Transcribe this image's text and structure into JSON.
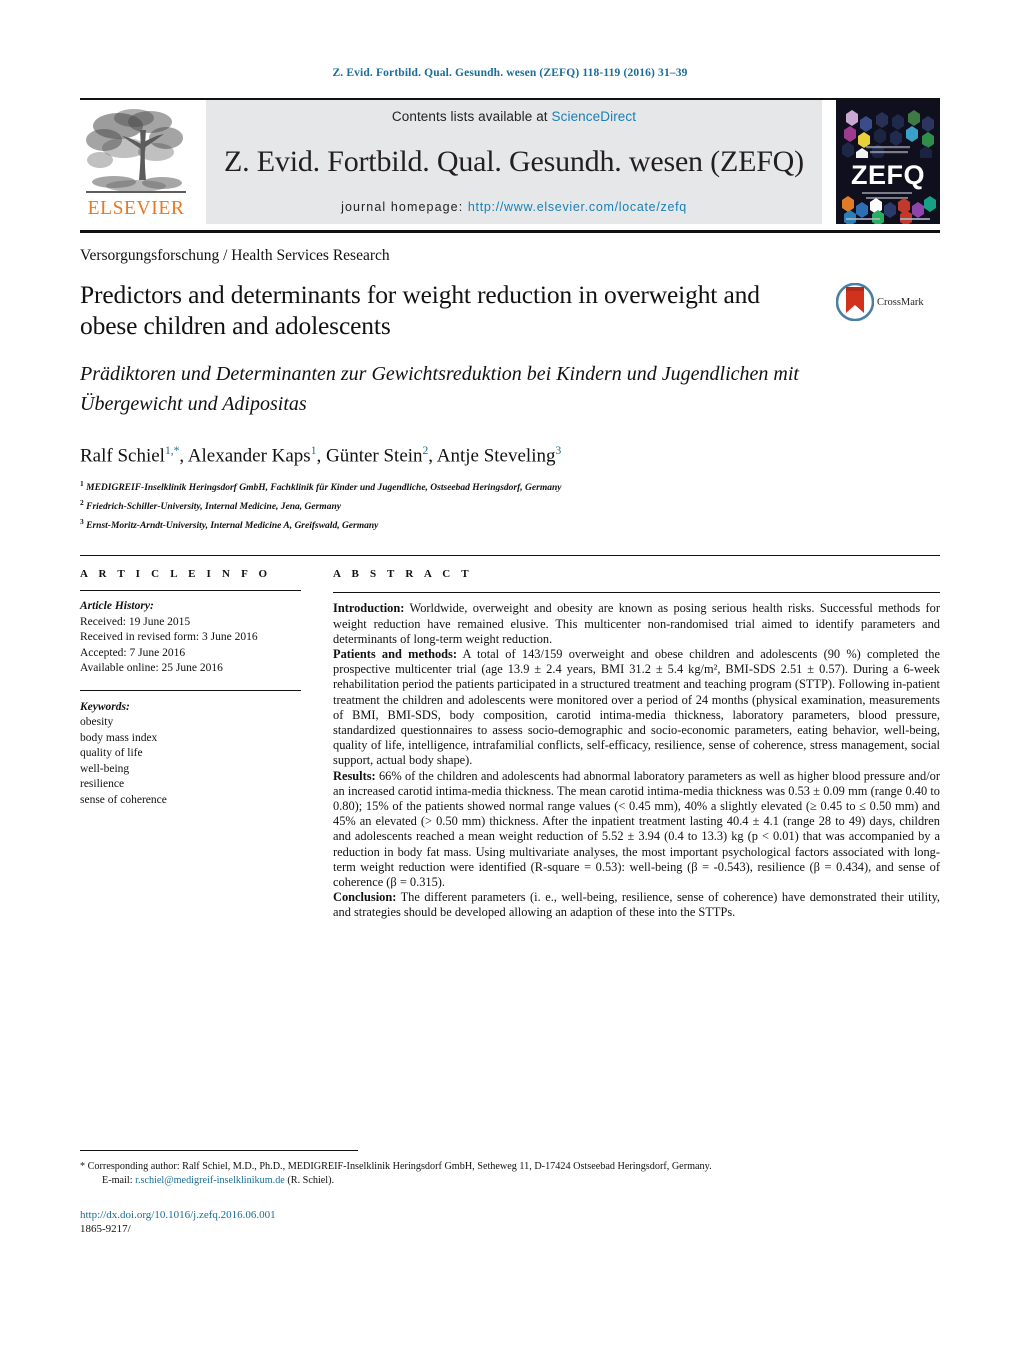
{
  "running_head": "Z. Evid. Fortbild. Qual. Gesundh. wesen (ZEFQ) 118-119 (2016) 31–39",
  "masthead": {
    "contents_prefix": "Contents lists available at ",
    "sciencedirect": "ScienceDirect",
    "journal_title": "Z. Evid. Fortbild. Qual. Gesundh. wesen (ZEFQ)",
    "homepage_label": "journal homepage:",
    "homepage_url": "http://www.elsevier.com/locate/zefq",
    "publisher_wordmark": "ELSEVIER",
    "cover_wordmark": "ZEFQ",
    "colors": {
      "link": "#1a7fb5",
      "running_head": "#1a6d96",
      "elsevier_orange": "#E87722",
      "band_gray": "#e6e7e8",
      "cover_bg": "#0f0f1e"
    }
  },
  "article": {
    "section_label": "Versorgungsforschung / Health Services Research",
    "title": "Predictors and determinants for weight reduction in overweight and obese children and adolescents",
    "subtitle": "Prädiktoren und Determinanten zur Gewichtsreduktion bei Kindern und Jugendlichen mit Übergewicht und Adipositas",
    "authors_plain": "Ralf Schiel1,*, Alexander Kaps1, Günter Stein2, Antje Steveling3",
    "affiliations": [
      {
        "marker": "1",
        "text": "MEDIGREIF-Inselklinik Heringsdorf GmbH, Fachklinik für Kinder und Jugendliche, Ostseebad Heringsdorf, Germany"
      },
      {
        "marker": "2",
        "text": "Friedrich-Schiller-University, Internal Medicine, Jena, Germany"
      },
      {
        "marker": "3",
        "text": "Ernst-Moritz-Arndt-University, Internal Medicine A, Greifswald, Germany"
      }
    ],
    "crossmark_label": "CrossMark"
  },
  "article_info": {
    "heading": "A R T I C L E   I N F O",
    "history_label": "Article History:",
    "history": [
      "Received: 19 June 2015",
      "Received in revised form: 3 June 2016",
      "Accepted: 7 June 2016",
      "Available online: 25 June 2016"
    ],
    "keywords_label": "Keywords:",
    "keywords": [
      "obesity",
      "body mass index",
      "quality of life",
      "well-being",
      "resilience",
      "sense of coherence"
    ]
  },
  "abstract": {
    "heading": "A B S T R A C T",
    "sections": [
      {
        "label": "Introduction:",
        "text": " Worldwide, overweight and obesity are known as posing serious health risks. Successful methods for weight reduction have remained elusive. This multicenter non-randomised trial aimed to identify parameters and determinants of long-term weight reduction."
      },
      {
        "label": "Patients and methods:",
        "text": " A total of 143/159 overweight and obese children and adolescents (90 %) completed the prospective multicenter trial (age 13.9 ± 2.4 years, BMI 31.2 ± 5.4 kg/m², BMI-SDS 2.51 ± 0.57). During a 6-week rehabilitation period the patients participated in a structured treatment and teaching program (STTP). Following in-patient treatment the children and adolescents were monitored over a period of 24 months (physical examination, measurements of BMI, BMI-SDS, body composition, carotid intima-media thickness, laboratory parameters, blood pressure, standardized questionnaires to assess socio-demographic and socio-economic parameters, eating behavior, well-being, quality of life, intelligence, intrafamilial conflicts, self-efficacy, resilience, sense of coherence, stress management, social support, actual body shape)."
      },
      {
        "label": "Results:",
        "text": " 66% of the children and adolescents had abnormal laboratory parameters as well as higher blood pressure and/or an increased carotid intima-media thickness. The mean carotid intima-media thickness was 0.53 ± 0.09 mm (range 0.40 to 0.80); 15% of the patients showed normal range values (< 0.45 mm), 40% a slightly elevated (≥ 0.45 to ≤ 0.50 mm) and 45% an elevated (> 0.50 mm) thickness. After the inpatient treatment lasting 40.4 ± 4.1 (range 28 to 49) days, children and adolescents reached a mean weight reduction of 5.52 ± 3.94 (0.4 to 13.3) kg (p < 0.01) that was accompanied by a reduction in body fat mass. Using multivariate analyses, the most important psychological factors associated with long-term weight reduction were identified (R-square = 0.53): well-being (β = -0.543), resilience (β = 0.434), and sense of coherence (β = 0.315)."
      },
      {
        "label": "Conclusion:",
        "text": " The different parameters (i. e., well-being, resilience, sense of coherence) have demonstrated their utility, and strategies should be developed allowing an adaption of these into the STTPs."
      }
    ]
  },
  "footer": {
    "corresponding_line1": "* Corresponding author: Ralf Schiel, M.D., Ph.D., MEDIGREIF-Inselklinik Heringsdorf GmbH, Setheweg 11, D-17424 Ostseebad Heringsdorf, Germany.",
    "email_prefix": "E-mail: ",
    "email": "r.schiel@medigreif-inselklinikum.de",
    "email_suffix": " (R. Schiel).",
    "doi": "http://dx.doi.org/10.1016/j.zefq.2016.06.001",
    "issn": "1865-9217/"
  }
}
